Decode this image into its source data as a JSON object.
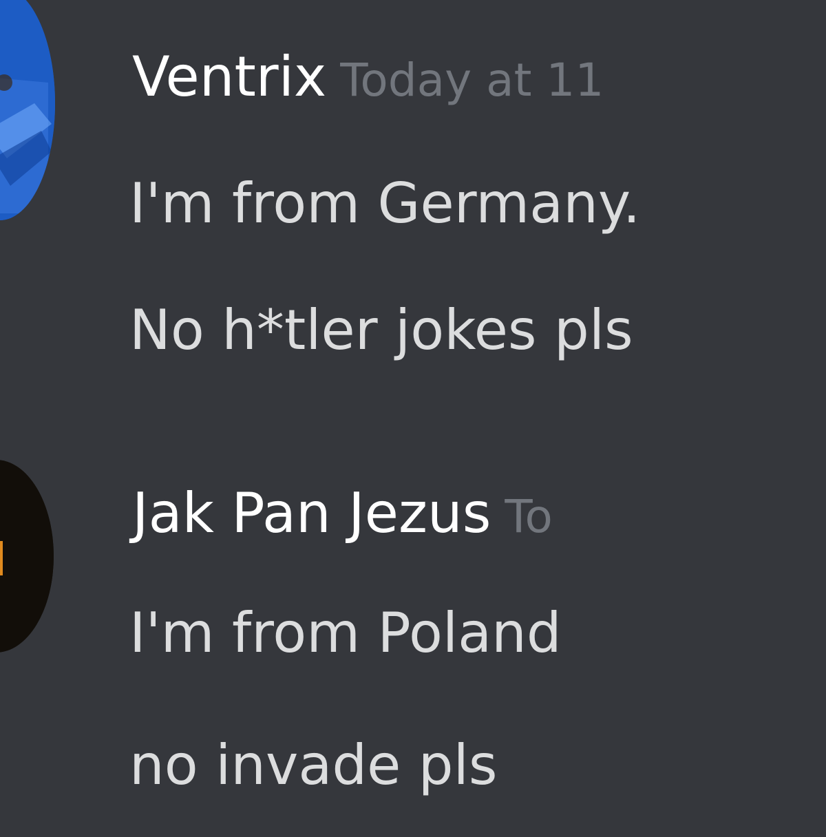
{
  "messages": [
    {
      "username": "Ventrix",
      "timestamp": "Today at 11",
      "lines": [
        "I'm from Germany.",
        "No h*tler jokes pls"
      ]
    },
    {
      "username": "Jak Pan Jezus",
      "timestamp": "To",
      "lines": [
        "I'm from Poland",
        "no invade pls"
      ]
    }
  ],
  "colors": {
    "background": "#35373c",
    "username": "#ffffff",
    "timestamp": "#72767d",
    "message_text": "#dcddde",
    "avatar_1": "#1e5fc8",
    "avatar_2": "#120e09"
  },
  "icons": [
    "user-avatar",
    "user-avatar"
  ]
}
